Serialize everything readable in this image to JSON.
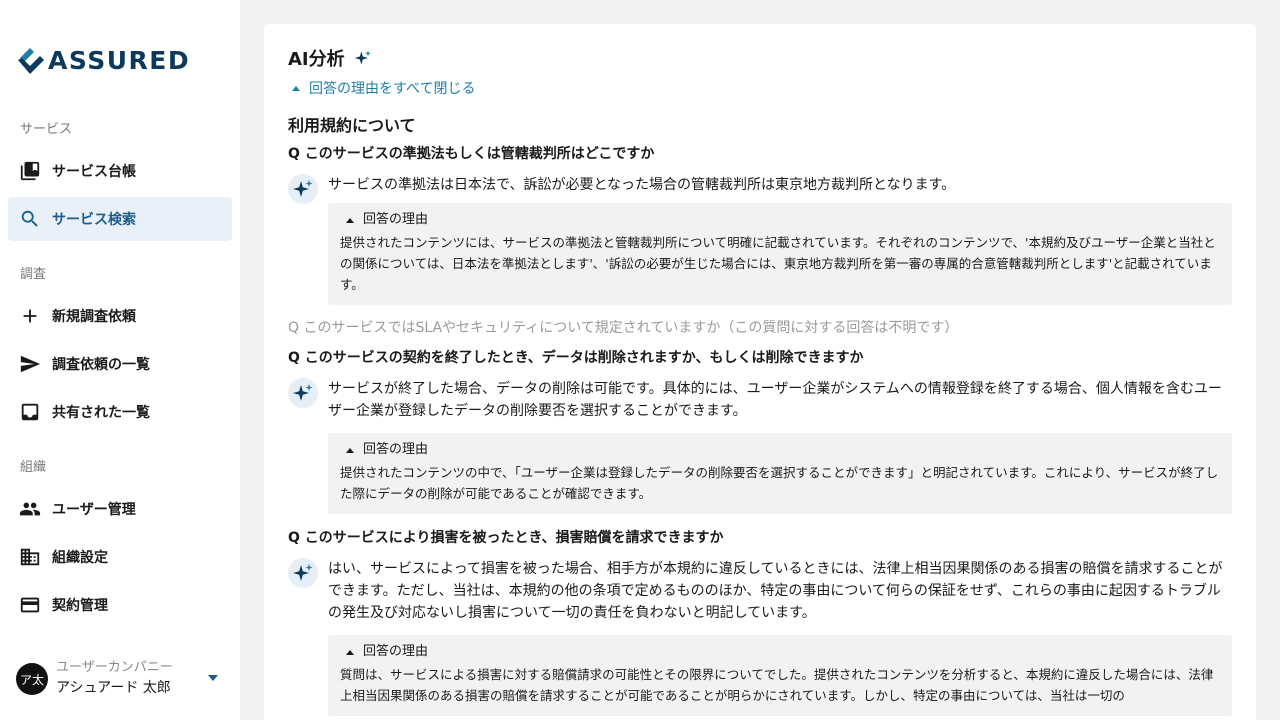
{
  "logo": {
    "text": "ASSURED"
  },
  "sidebar": {
    "sections": [
      {
        "label": "サービス"
      },
      {
        "label": "調査"
      },
      {
        "label": "組織"
      }
    ],
    "items": [
      {
        "label": "サービス台帳",
        "icon": "library-icon"
      },
      {
        "label": "サービス検索",
        "icon": "search-icon",
        "active": true
      },
      {
        "label": "新規調査依頼",
        "icon": "plus-icon"
      },
      {
        "label": "調査依頼の一覧",
        "icon": "send-icon"
      },
      {
        "label": "共有された一覧",
        "icon": "inbox-icon"
      },
      {
        "label": "ユーザー管理",
        "icon": "people-icon"
      },
      {
        "label": "組織設定",
        "icon": "building-icon"
      },
      {
        "label": "契約管理",
        "icon": "credit-card-icon"
      }
    ]
  },
  "user": {
    "avatar": "ア太",
    "company": "ユーザーカンパニー",
    "name": "アシュアード 太郎"
  },
  "main": {
    "title": "AI分析",
    "collapse_all": "回答の理由をすべて閉じる",
    "section_title": "利用規約について",
    "reason_label": "回答の理由",
    "qa": [
      {
        "question": "Q このサービスの準拠法もしくは管轄裁判所はどこですか",
        "answer": "サービスの準拠法は日本法で、訴訟が必要となった場合の管轄裁判所は東京地方裁判所となります。",
        "reason": "提供されたコンテンツには、サービスの準拠法と管轄裁判所について明確に記載されています。それぞれのコンテンツで、'本規約及びユーザー企業と当社との関係については、日本法を準拠法とします'、'訴訟の必要が生じた場合には、東京地方裁判所を第一審の専属的合意管轄裁判所とします'と記載されています。"
      },
      {
        "question": "Q このサービスではSLAやセキュリティについて規定されていますか（この質問に対する回答は不明です）"
      },
      {
        "question": "Q このサービスの契約を終了したとき、データは削除されますか、もしくは削除できますか",
        "answer": "サービスが終了した場合、データの削除は可能です。具体的には、ユーザー企業がシステムへの情報登録を終了する場合、個人情報を含むユーザー企業が登録したデータの削除要否を選択することができます。",
        "reason": "提供されたコンテンツの中で、「ユーザー企業は登録したデータの削除要否を選択することができます」と明記されています。これにより、サービスが終了した際にデータの削除が可能であることが確認できます。"
      },
      {
        "question": "Q このサービスにより損害を被ったとき、損害賠償を請求できますか",
        "answer": "はい、サービスによって損害を被った場合、相手方が本規約に違反しているときには、法律上相当因果関係のある損害の賠償を請求することができます。ただし、当社は、本規約の他の条項で定めるもののほか、特定の事由について何らの保証をせず、これらの事由に起因するトラブルの発生及び対応ないし損害について一切の責任を負わないと明記しています。",
        "reason": "質問は、サービスによる損害に対する賠償請求の可能性とその限界についてでした。提供されたコンテンツを分析すると、本規約に違反した場合には、法律上相当因果関係のある損害の賠償を請求することが可能であることが明らかにされています。しかし、特定の事由については、当社は一切の"
      }
    ]
  },
  "colors": {
    "brand": "#0d3a5c",
    "accent": "#1c5c8e",
    "link": "#1d7fa8",
    "active_bg": "#e9f0f7"
  }
}
